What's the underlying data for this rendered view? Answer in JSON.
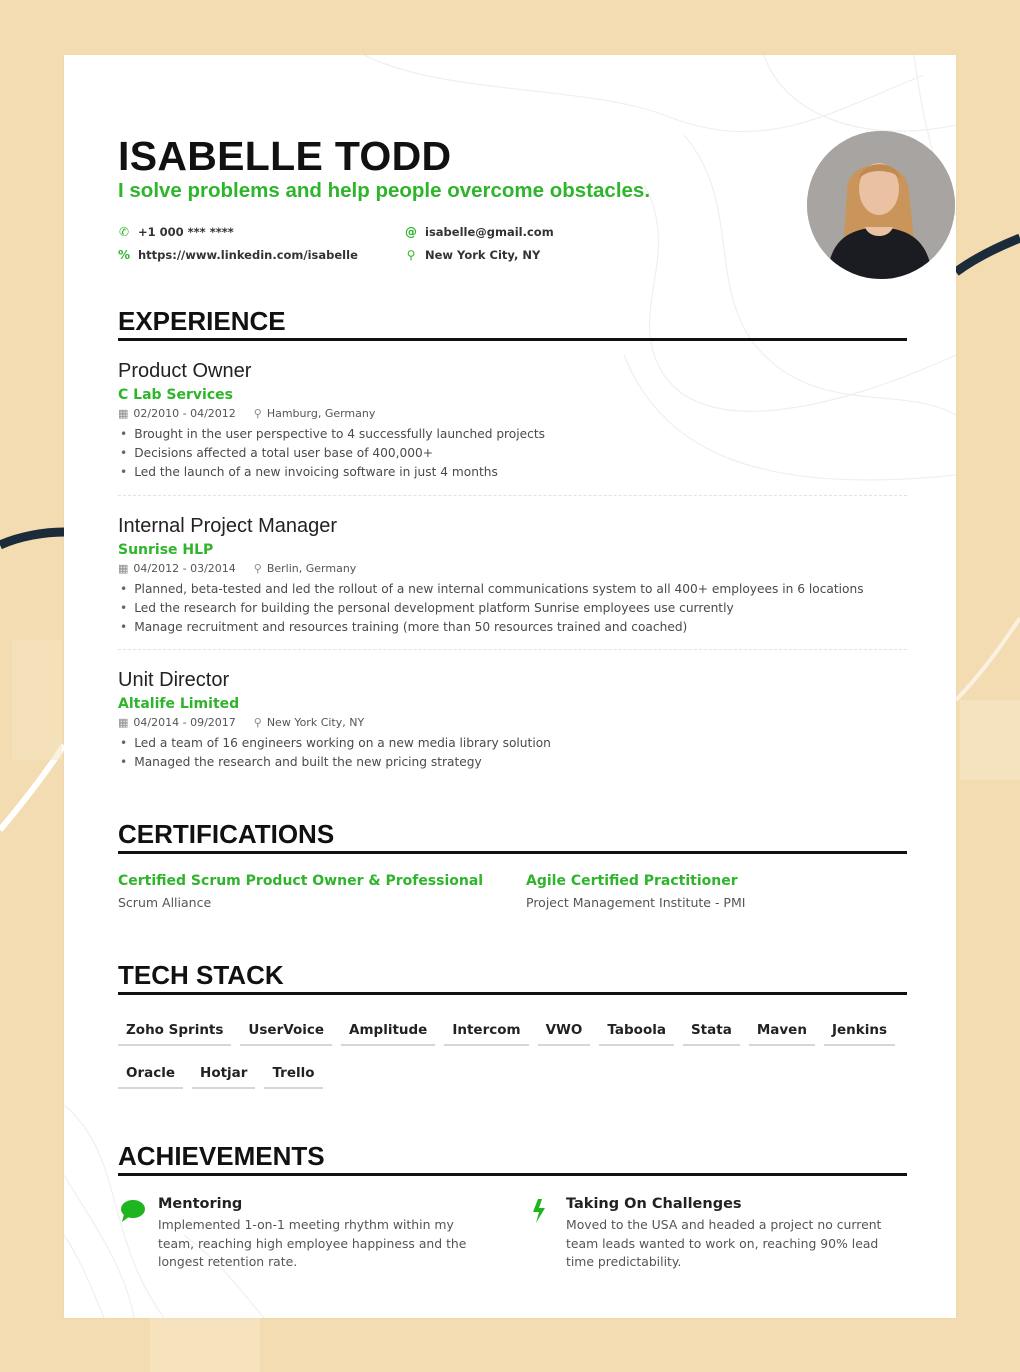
{
  "header": {
    "name": "ISABELLE TODD",
    "tagline": "I solve problems and help people overcome obstacles.",
    "contacts": [
      {
        "icon": "phone-icon",
        "value": "+1 000 *** ****"
      },
      {
        "icon": "link-icon",
        "value": "https://www.linkedin.com/isabelle"
      },
      {
        "icon": "at-icon",
        "value": "isabelle@gmail.com"
      },
      {
        "icon": "location-pin-icon",
        "value": "New York City, NY"
      }
    ],
    "photo_alt": "Profile photo of Isabelle Todd"
  },
  "experience": {
    "title": "EXPERIENCE",
    "jobs": [
      {
        "title": "Product Owner",
        "company": "C Lab Services",
        "dates": "02/2010 - 04/2012",
        "location": "Hamburg, Germany",
        "bullets": [
          "Brought in the user perspective to 4 successfully launched projects",
          "Decisions affected a total user base of 400,000+",
          "Led the launch of a new invoicing software in just 4 months"
        ]
      },
      {
        "title": "Internal Project Manager",
        "company": "Sunrise HLP",
        "dates": "04/2012 - 03/2014",
        "location": "Berlin, Germany",
        "bullets": [
          "Planned, beta-tested and led the rollout of a new internal communications system to all 400+ employees in 6 locations",
          "Led the research for building the personal development platform Sunrise employees use currently",
          "Manage recruitment and resources training (more than 50 resources trained and coached)"
        ]
      },
      {
        "title": "Unit Director",
        "company": "Altalife Limited",
        "dates": "04/2014 - 09/2017",
        "location": "New York City, NY",
        "bullets": [
          "Led a team of 16 engineers working on a new media library solution",
          "Managed the research and built the new pricing strategy"
        ]
      }
    ]
  },
  "certifications": {
    "title": "CERTIFICATIONS",
    "items": [
      {
        "name": "Certified Scrum Product Owner & Professional",
        "issuer": "Scrum Alliance"
      },
      {
        "name": "Agile Certified Practitioner",
        "issuer": "Project Management Institute - PMI"
      }
    ]
  },
  "tech_stack": {
    "title": "TECH STACK",
    "items": [
      "Zoho Sprints",
      "UserVoice",
      "Amplitude",
      "Intercom",
      "VWO",
      "Taboola",
      "Stata",
      "Maven",
      "Jenkins",
      "Oracle",
      "Hotjar",
      "Trello"
    ]
  },
  "achievements": {
    "title": "ACHIEVEMENTS",
    "items": [
      {
        "icon": "speech-bubble-icon",
        "title": "Mentoring",
        "description": "Implemented 1-on-1 meeting rhythm within my team, reaching high employee happiness and the longest retention rate."
      },
      {
        "icon": "lightning-bolt-icon",
        "title": "Taking On Challenges",
        "description": "Moved to the USA and headed a project no current team leads wanted to work on, reaching 90% lead time predictability."
      }
    ]
  },
  "colors": {
    "accent": "#2fb52b",
    "background": "#f3dcb1",
    "heading": "#111111",
    "decor_navy": "#1c2b3a"
  }
}
